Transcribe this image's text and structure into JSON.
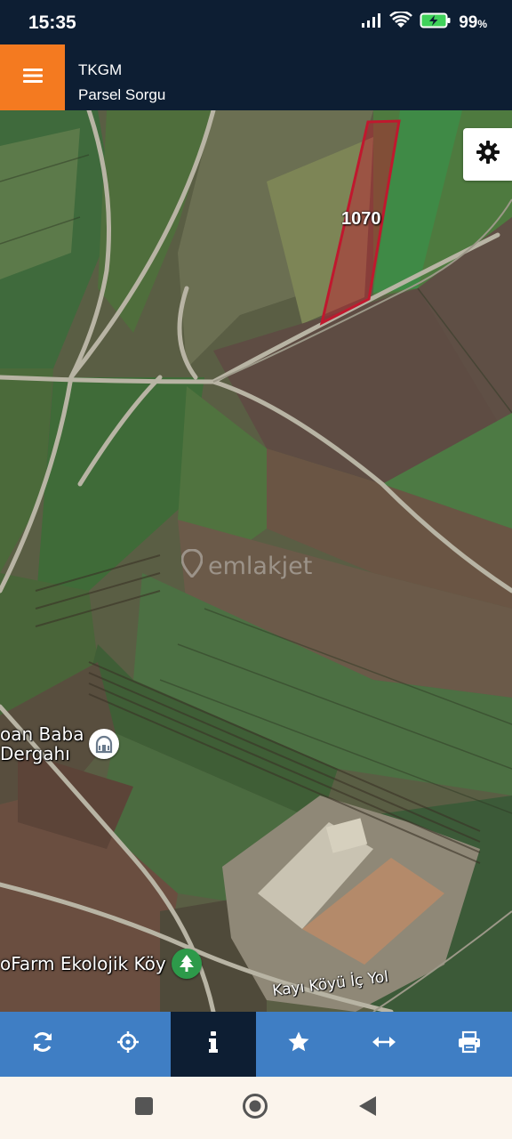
{
  "status_bar": {
    "time": "15:35",
    "battery_percent": "99",
    "battery_unit": "%",
    "icons": [
      "signal-icon",
      "wifi-icon",
      "battery-charging-icon"
    ]
  },
  "header": {
    "menu_icon": "hamburger-menu-icon",
    "title": "TKGM",
    "subtitle": "Parsel Sorgu",
    "accent_color": "#f47a20",
    "background_color": "#0d1e33"
  },
  "map": {
    "parcel_label": "1070",
    "parcel_color": "#c0182e",
    "watermark_text": "emlakjet",
    "pois": [
      {
        "label_line1": "oan Baba",
        "label_line2": "Dergahı",
        "icon": "mosque-icon"
      },
      {
        "label_line1": "oFarm Ekolojik Köy",
        "label_line2": "",
        "icon": "tree-icon"
      }
    ],
    "road_label": "Kayı Köyü İç Yol",
    "settings_icon": "gear-icon"
  },
  "toolbar": {
    "background_color": "#3f7ec4",
    "active_color": "#0d1e33",
    "buttons": [
      {
        "icon": "refresh-icon",
        "active": false
      },
      {
        "icon": "crosshair-icon",
        "active": false
      },
      {
        "icon": "info-icon",
        "active": true
      },
      {
        "icon": "star-icon",
        "active": false
      },
      {
        "icon": "measure-arrows-icon",
        "active": false
      },
      {
        "icon": "print-icon",
        "active": false
      }
    ]
  },
  "nav_bar": {
    "buttons": [
      "recents-square-icon",
      "home-circle-icon",
      "back-triangle-icon"
    ]
  }
}
